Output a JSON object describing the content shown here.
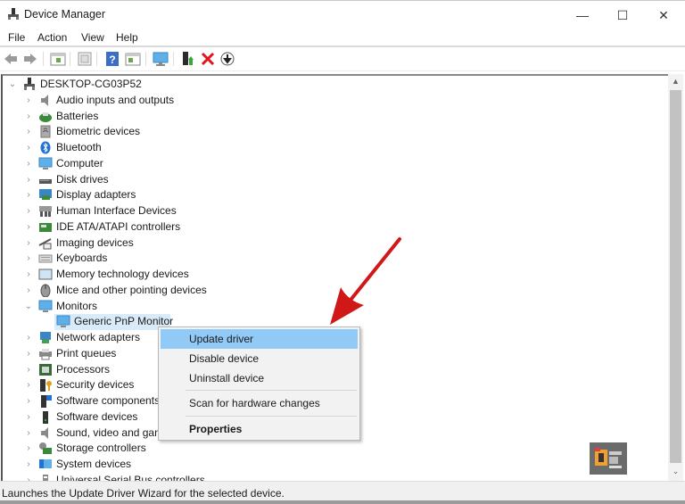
{
  "window": {
    "title": "Device Manager",
    "controls": {
      "minimize": "—",
      "maximize": "☐",
      "close": "✕"
    }
  },
  "menu": [
    "File",
    "Action",
    "View",
    "Help"
  ],
  "toolbar": {
    "icons": [
      "back-icon",
      "forward-icon",
      "show-hide-console-tree-icon",
      "properties-icon",
      "help-icon",
      "action-pane-icon",
      "monitor-scan-icon",
      "update-driver-icon",
      "uninstall-icon",
      "disable-icon"
    ]
  },
  "tree": {
    "root": "DESKTOP-CG03P52",
    "categories": [
      {
        "label": "Audio inputs and outputs",
        "icon": "speaker-icon",
        "expanded": false
      },
      {
        "label": "Batteries",
        "icon": "battery-icon",
        "expanded": false
      },
      {
        "label": "Biometric devices",
        "icon": "biometric-icon",
        "expanded": false
      },
      {
        "label": "Bluetooth",
        "icon": "bluetooth-icon",
        "expanded": false
      },
      {
        "label": "Computer",
        "icon": "computer-icon",
        "expanded": false
      },
      {
        "label": "Disk drives",
        "icon": "disk-drive-icon",
        "expanded": false
      },
      {
        "label": "Display adapters",
        "icon": "display-adapter-icon",
        "expanded": false
      },
      {
        "label": "Human Interface Devices",
        "icon": "hid-icon",
        "expanded": false
      },
      {
        "label": "IDE ATA/ATAPI controllers",
        "icon": "ide-controller-icon",
        "expanded": false
      },
      {
        "label": "Imaging devices",
        "icon": "camera-icon",
        "expanded": false
      },
      {
        "label": "Keyboards",
        "icon": "keyboard-icon",
        "expanded": false
      },
      {
        "label": "Memory technology devices",
        "icon": "memory-icon",
        "expanded": false
      },
      {
        "label": "Mice and other pointing devices",
        "icon": "mouse-icon",
        "expanded": false
      },
      {
        "label": "Monitors",
        "icon": "monitor-icon",
        "expanded": true,
        "children": [
          "Generic PnP Monitor"
        ]
      },
      {
        "label": "Network adapters",
        "icon": "network-icon",
        "expanded": false
      },
      {
        "label": "Print queues",
        "icon": "printer-icon",
        "expanded": false
      },
      {
        "label": "Processors",
        "icon": "processor-icon",
        "expanded": false
      },
      {
        "label": "Security devices",
        "icon": "security-icon",
        "expanded": false
      },
      {
        "label": "Software components",
        "icon": "software-component-icon",
        "expanded": false
      },
      {
        "label": "Software devices",
        "icon": "software-device-icon",
        "expanded": false
      },
      {
        "label": "Sound, video and game controllers",
        "icon": "sound-icon",
        "expanded": false
      },
      {
        "label": "Storage controllers",
        "icon": "storage-icon",
        "expanded": false
      },
      {
        "label": "System devices",
        "icon": "system-icon",
        "expanded": false
      },
      {
        "label": "Universal Serial Bus controllers",
        "icon": "usb-icon",
        "expanded": false
      }
    ],
    "selected": "Generic PnP Monitor"
  },
  "context_menu": {
    "items": [
      {
        "label": "Update driver",
        "highlighted": true
      },
      {
        "label": "Disable device"
      },
      {
        "label": "Uninstall device"
      },
      {
        "label": "Scan for hardware changes"
      },
      {
        "label": "Properties",
        "bold": true
      }
    ]
  },
  "status": "Launches the Update Driver Wizard for the selected device.",
  "colors": {
    "selection": "#d9ebf9",
    "menu_highlight": "#91c9f7",
    "arrow": "#d01818"
  }
}
